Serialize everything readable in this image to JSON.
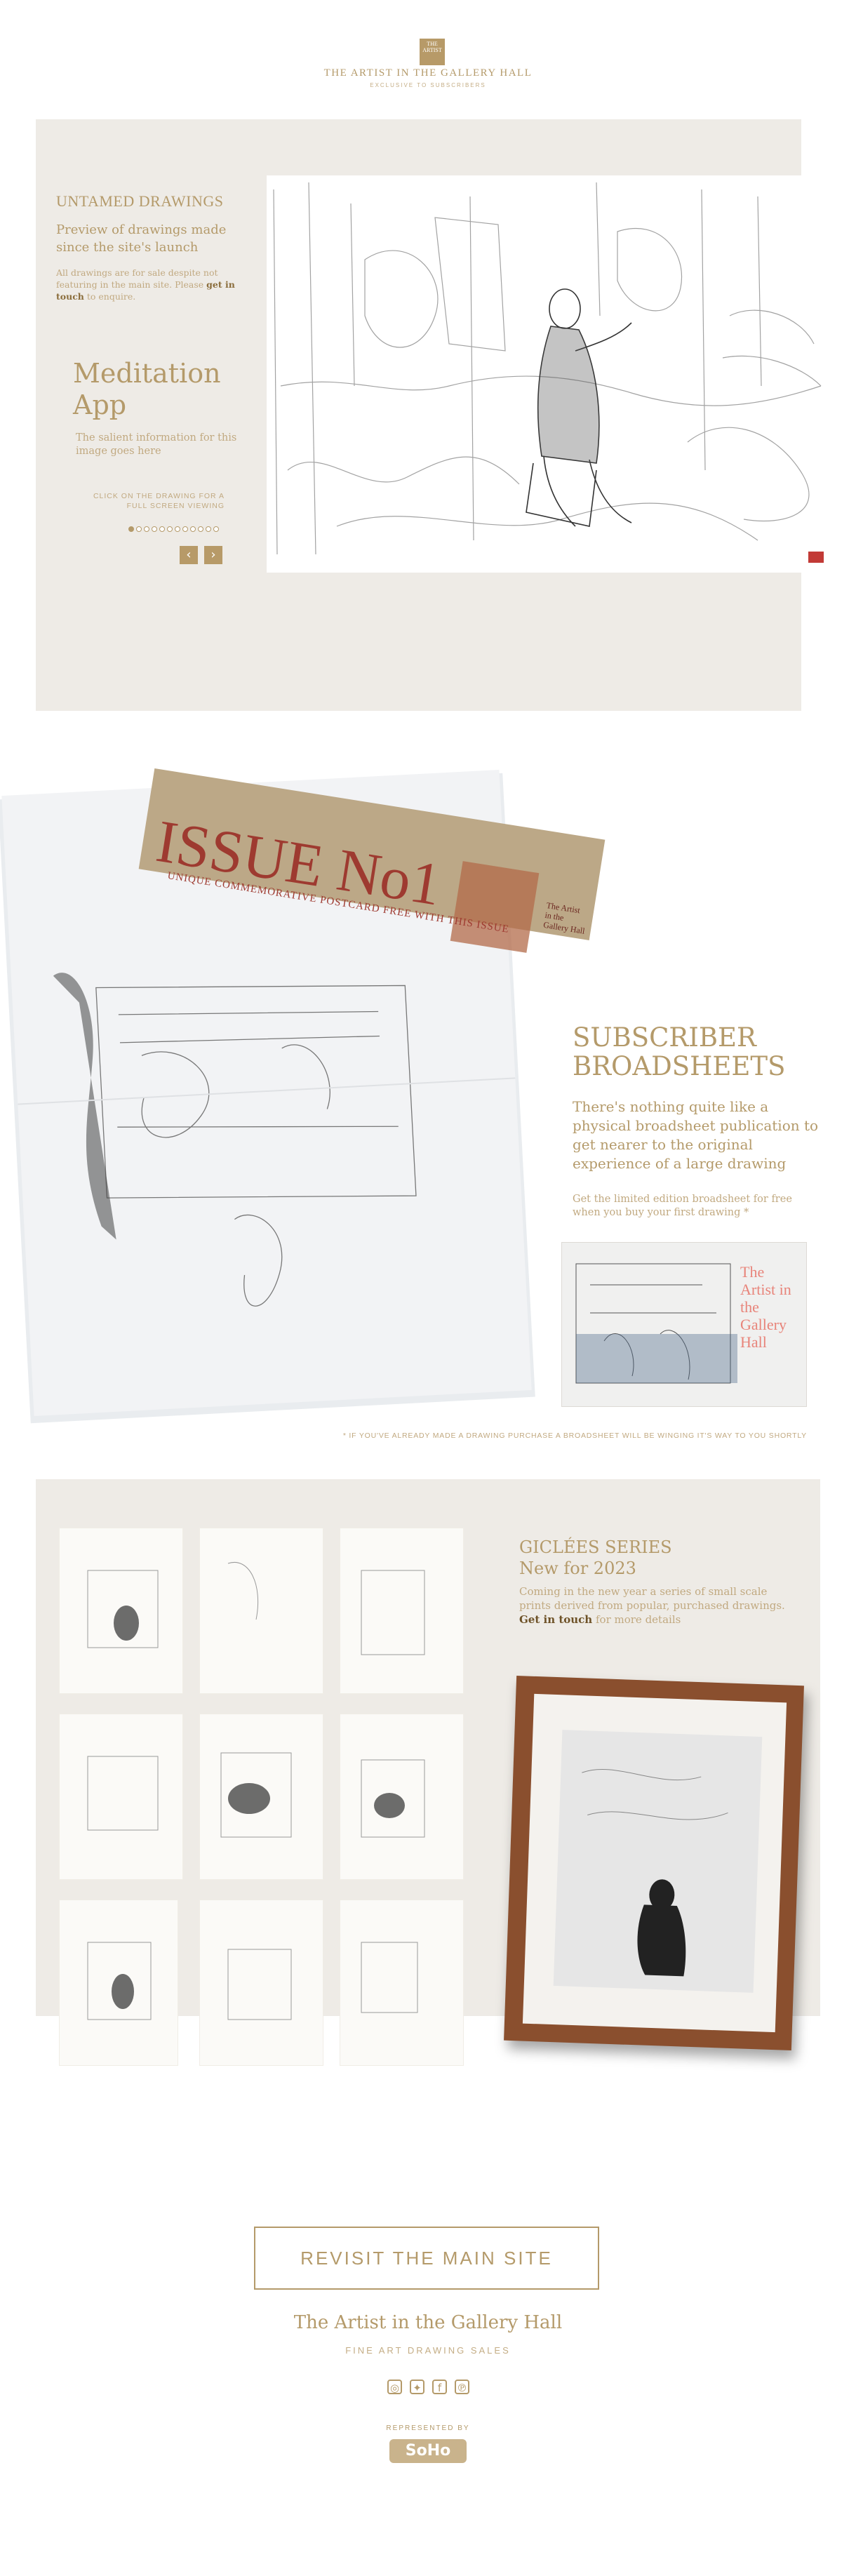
{
  "header": {
    "logo_text": "THE ARTIST",
    "title": "THE ARTIST IN THE GALLERY HALL",
    "subtitle": "EXCLUSIVE TO SUBSCRIBERS"
  },
  "drawings": {
    "heading": "UNTAMED DRAWINGS",
    "preview": "Preview of drawings made since the site's launch",
    "note_before": "All drawings are for sale despite not featuring in the main site. Please ",
    "note_link": "get in touch",
    "note_after": " to enquire.",
    "app_title": "Meditation App",
    "app_subtitle": "The salient information for this image goes here",
    "click_hint": "CLICK ON THE DRAWING FOR A FULL SCREEN VIEWING",
    "slide_count": 12,
    "active_slide": 1,
    "prev_icon": "chevron-left-icon",
    "next_icon": "chevron-right-icon",
    "prev_glyph": "‹",
    "next_glyph": "›"
  },
  "broadsheets": {
    "banner_title": "ISSUE No1",
    "banner_subtitle": "UNIQUE COMMEMORATIVE POSTCARD FREE WITH THIS ISSUE",
    "banner_side": "The Artist in the Gallery Hall",
    "heading": "SUBSCRIBER BROADSHEETS",
    "lead": "There's nothing quite like a physical broadsheet publication to get nearer to the original experience of a large drawing",
    "note": "Get the limited edition broadsheet for free when you buy your first drawing *",
    "photo_title": "The Artist in the Gallery Hall",
    "footnote": "* IF YOU'VE ALREADY MADE A DRAWING PURCHASE A BROADSHEET WILL BE WINGING IT'S WAY TO YOU SHORTLY"
  },
  "giclees": {
    "heading_line1": "GICLÉES SERIES",
    "heading_line2": "New for 2023",
    "text_before": "Coming in the new year a series of small scale prints derived from popular, purchased drawings. ",
    "text_link": "Get in touch",
    "text_after": " for more details"
  },
  "footer": {
    "button_label": "REVISIT THE MAIN SITE",
    "title": "The Artist in the Gallery Hall",
    "subtitle": "FINE ART DRAWING SALES",
    "social_icons": [
      "instagram-icon",
      "twitter-icon",
      "facebook-icon",
      "pinterest-icon"
    ],
    "social_glyphs": [
      "◎",
      "✦",
      "f",
      "℗"
    ],
    "represented_by": "REPRESENTED BY",
    "brand": "SoHo"
  },
  "colors": {
    "accent": "#b49a6a",
    "panel": "#eeebe6",
    "banner_red": "#9e3a30",
    "frame_wood": "#8a4f2e"
  }
}
